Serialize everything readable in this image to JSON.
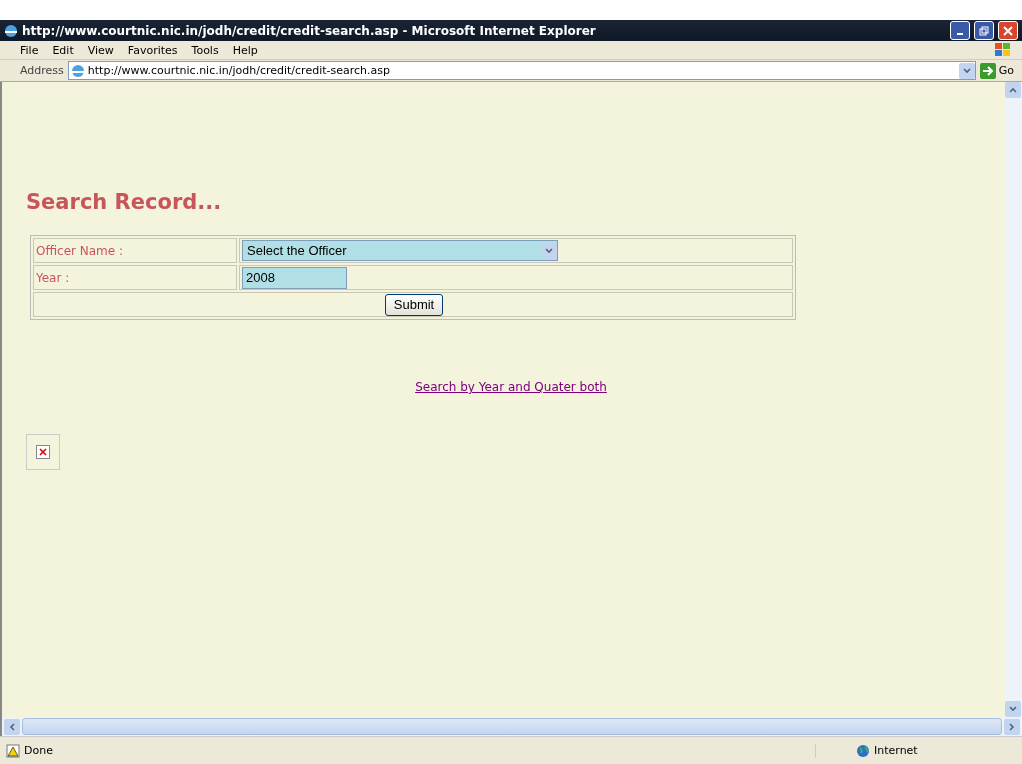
{
  "window": {
    "title": "http://www.courtnic.nic.in/jodh/credit/credit-search.asp - Microsoft Internet Explorer"
  },
  "menu": [
    {
      "label": "File"
    },
    {
      "label": "Edit"
    },
    {
      "label": "View"
    },
    {
      "label": "Favorites"
    },
    {
      "label": "Tools"
    },
    {
      "label": "Help"
    }
  ],
  "address_bar": {
    "label": "Address",
    "value": "http://www.courtnic.nic.in/jodh/credit/credit-search.asp",
    "go": "Go"
  },
  "page": {
    "heading": "Search Record...",
    "form": {
      "officer_label": "Officer Name :",
      "officer_value": "Select the Officer",
      "year_label": "Year :",
      "year_value": "2008",
      "submit": "Submit"
    },
    "link": "Search by Year and Quater both"
  },
  "status_bar": {
    "text": "Done",
    "zone": "Internet"
  }
}
